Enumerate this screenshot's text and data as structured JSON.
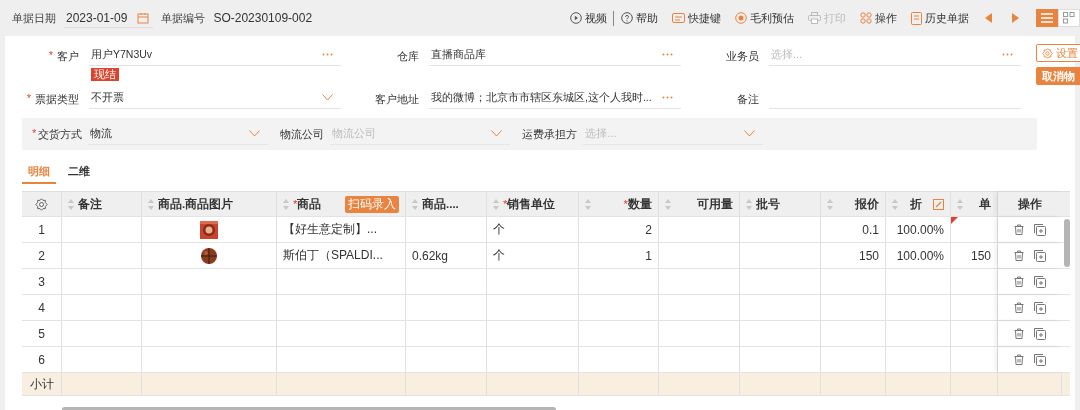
{
  "header": {
    "date_label": "单据日期",
    "date": "2023-01-09",
    "number_label": "单据编号",
    "number": "SO-20230109-002"
  },
  "toolbar": [
    {
      "kind": "play",
      "label": "视频",
      "disabled": false
    },
    {
      "kind": "help",
      "label": "帮助",
      "disabled": false
    },
    {
      "kind": "keyboard",
      "label": "快捷键",
      "disabled": false
    },
    {
      "kind": "target",
      "label": "毛利预估",
      "disabled": false
    },
    {
      "kind": "print",
      "label": "打印",
      "disabled": true
    },
    {
      "kind": "grid",
      "label": "操作",
      "disabled": false
    },
    {
      "kind": "doc",
      "label": "历史单据",
      "disabled": false
    }
  ],
  "view_toggle": [
    {
      "kind": "list",
      "selected": true
    },
    {
      "kind": "grid",
      "selected": false
    }
  ],
  "side_buttons": [
    {
      "kind": "settings",
      "label": "设置"
    },
    {
      "kind": "primary",
      "label": "取消物"
    }
  ],
  "form": {
    "fields": [
      {
        "label": "客户",
        "required_mark": "*",
        "kind": "lookup",
        "value": "用户Y7N3Uv",
        "badge": "现结"
      },
      {
        "label": "仓库",
        "kind": "lookup",
        "value": "直播商品库"
      },
      {
        "label": "业务员",
        "kind": "lookup",
        "placeholder": "选择..."
      },
      {
        "label": "票据类型",
        "required_mark": "*",
        "kind": "select",
        "value": "不开票"
      },
      {
        "label": "客户地址",
        "kind": "lookup",
        "value": "我的微博；北京市市辖区东城区,这个人我时..."
      },
      {
        "label": "备注",
        "kind": "text"
      }
    ]
  },
  "logistics": [
    {
      "label": "交货方式",
      "required_mark": "*",
      "kind": "select",
      "value": "物流"
    },
    {
      "label": "物流公司",
      "kind": "select",
      "placeholder": "物流公司"
    },
    {
      "label": "运费承担方",
      "kind": "select",
      "placeholder": "选择..."
    }
  ],
  "tabs": [
    {
      "label": "明细",
      "selected": true
    },
    {
      "label": "二维",
      "selected": false
    }
  ],
  "table": {
    "columns": [
      {
        "label": "备注"
      },
      {
        "label": "商品.商品图片"
      },
      {
        "label": "商品",
        "required_mark": "*",
        "tag": "扫码录入"
      },
      {
        "label": "商品...."
      },
      {
        "label": "销售单位",
        "required_mark": "*"
      },
      {
        "label": "数量",
        "required_mark": "*"
      },
      {
        "label": "可用量"
      },
      {
        "label": "批号"
      },
      {
        "label": "报价"
      },
      {
        "label": "折",
        "editable": true
      },
      {
        "label": "单"
      }
    ],
    "actions_label": "操作",
    "rows": [
      {
        "number": "1",
        "image": true,
        "product": "【好生意定制】...",
        "unit": "个",
        "qty": "2",
        "price": "0.1",
        "discount": "100.00%",
        "flagged": true
      },
      {
        "number": "2",
        "image": true,
        "product": "斯伯丁（SPALDI...",
        "weight": "0.62kg",
        "unit": "个",
        "qty": "1",
        "price": "150",
        "discount": "100.00%",
        "unit_price": "150",
        "flagged": false
      },
      {
        "number": "3",
        "image": false,
        "flagged": false
      },
      {
        "number": "4",
        "image": false,
        "flagged": false
      },
      {
        "number": "5",
        "image": false,
        "flagged": false
      },
      {
        "number": "6",
        "image": false,
        "flagged": false
      }
    ],
    "subtotal_label": "小计"
  }
}
